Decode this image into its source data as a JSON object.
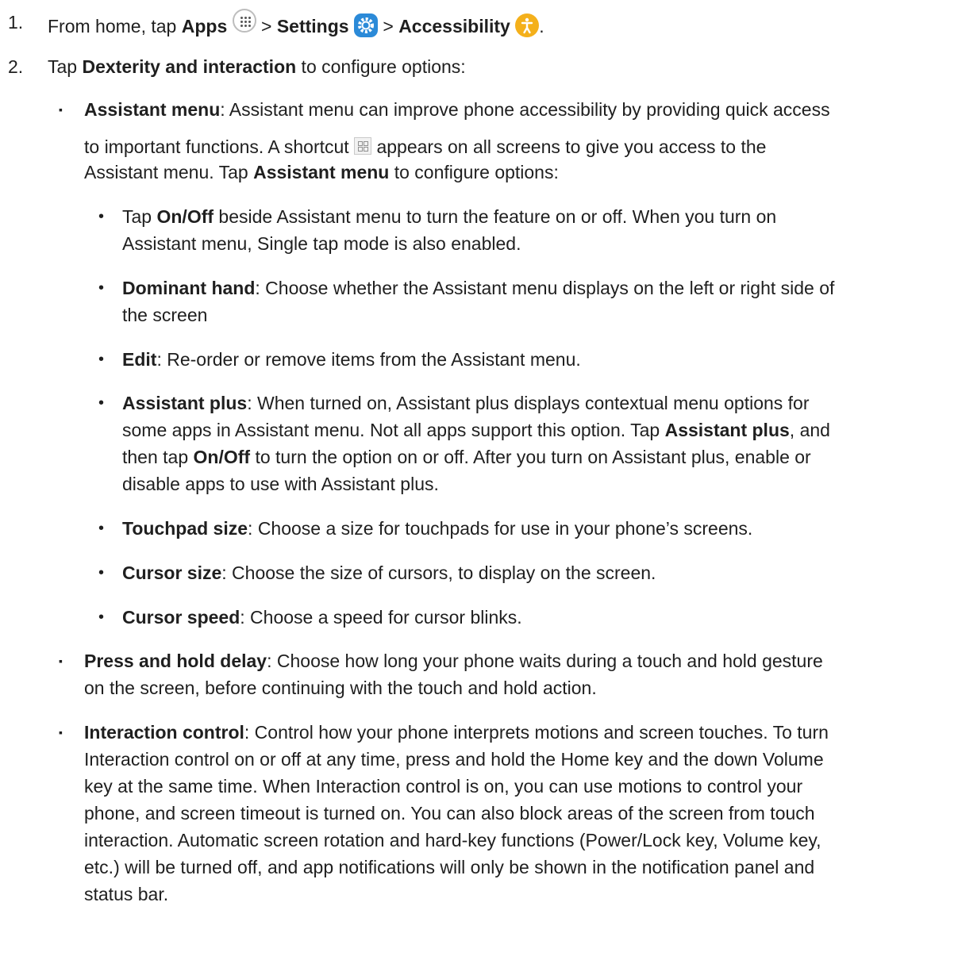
{
  "step1": {
    "number": "1.",
    "t1": "From home, tap ",
    "apps": "Apps",
    "sep1": " > ",
    "settings": "Settings",
    "sep2": " > ",
    "accessibility": "Accessibility",
    "end": "."
  },
  "step2": {
    "number": "2.",
    "t1": "Tap ",
    "dexterity": "Dexterity and interaction",
    "t2": " to configure options:"
  },
  "assistant_menu": {
    "bullet": "▪",
    "title": "Assistant menu",
    "l1": ": Assistant menu can improve phone accessibility by providing quick access",
    "l2a": "to important functions. A shortcut ",
    "l2b": " appears on all screens to give you access to the",
    "l3a": "Assistant menu. Tap ",
    "l3b": "Assistant menu",
    "l3c": " to configure options:"
  },
  "sub": {
    "bullet": "•",
    "onoff": {
      "t1": "Tap ",
      "b1": "On/Off",
      "t2": " beside Assistant menu to turn the feature on or off. When you turn on",
      "l2": "Assistant menu, Single tap mode is also enabled."
    },
    "dominant": {
      "title": "Dominant hand",
      "l1": ": Choose whether the Assistant menu displays on the left or right side of",
      "l2": "the screen"
    },
    "edit": {
      "title": "Edit",
      "l1": ": Re-order or remove items from the Assistant menu."
    },
    "plus": {
      "title": "Assistant plus",
      "l1": ": When turned on, Assistant plus displays contextual menu options for",
      "l2a": "some apps in Assistant menu. Not all apps support this option. Tap ",
      "l2b": "Assistant plus",
      "l2c": ", and",
      "l3a": "then tap ",
      "l3b": "On/Off",
      "l3c": " to turn the option on or off. After you turn on Assistant plus, enable or",
      "l4": "disable apps to use with Assistant plus."
    },
    "touchpad": {
      "title": "Touchpad size",
      "l1": ": Choose a size for touchpads for use in your phone’s screens."
    },
    "cursor_size": {
      "title": "Cursor size",
      "l1": ": Choose the size of cursors, to display on the screen."
    },
    "cursor_speed": {
      "title": "Cursor speed",
      "l1": ": Choose a speed for cursor blinks."
    }
  },
  "press_hold": {
    "bullet": "▪",
    "title": "Press and hold delay",
    "l1": ": Choose how long your phone waits during a touch and hold gesture",
    "l2": "on the screen, before continuing with the touch and hold action."
  },
  "interaction": {
    "bullet": "▪",
    "title": "Interaction control",
    "l1": ": Control how your phone interprets motions and screen touches. To turn",
    "l2": "Interaction control on or off at any time, press and hold the Home key and the down Volume",
    "l3": "key at the same time. When Interaction control is on, you can use motions to control your",
    "l4": "phone, and screen timeout is turned on. You can also block areas of the screen from touch",
    "l5": "interaction. Automatic screen rotation and hard-key functions (Power/Lock key, Volume key,",
    "l6": "etc.) will be turned off, and app notifications will only be shown in the notification panel and",
    "l7": "status bar."
  },
  "colors": {
    "text": "#1f1f1f",
    "settings_icon": "#2b8ad8",
    "accessibility_icon": "#f4b01b"
  }
}
